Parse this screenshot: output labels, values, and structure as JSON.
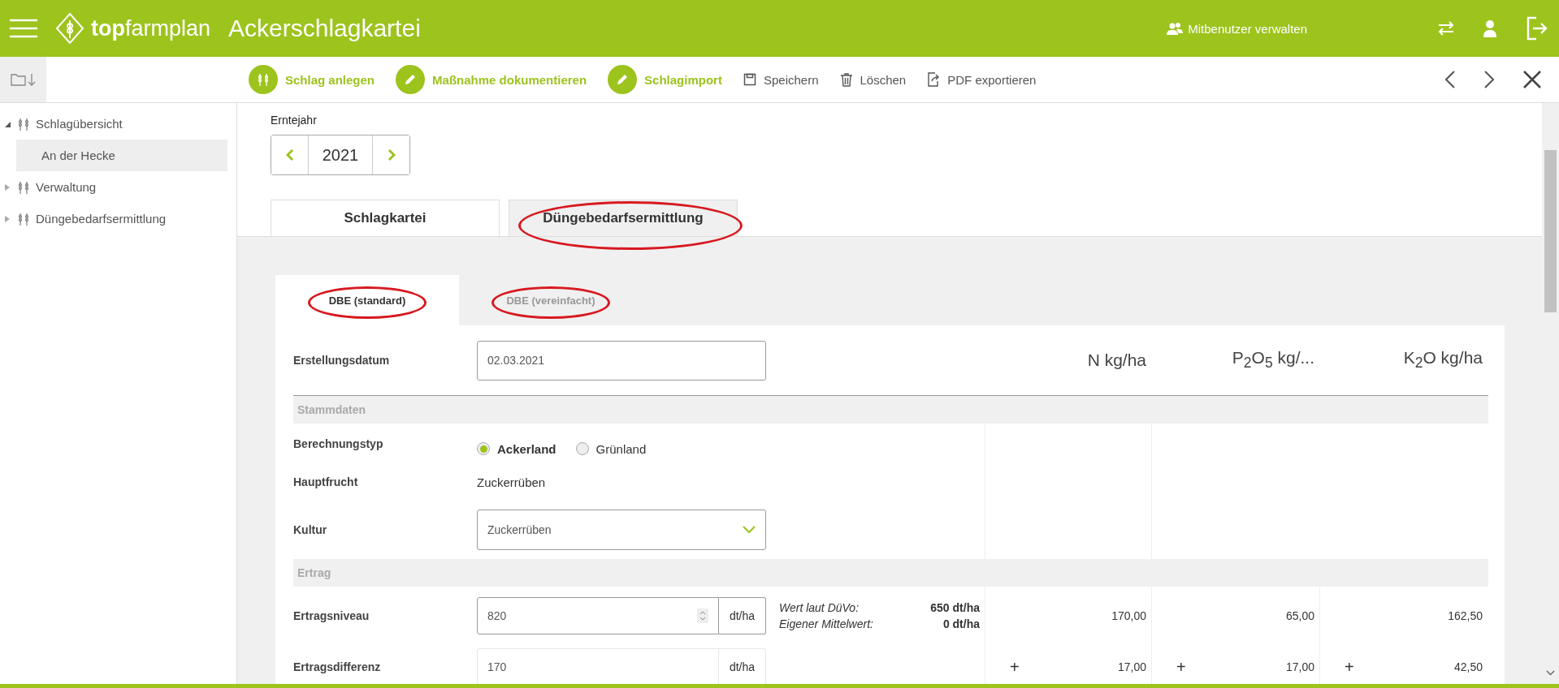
{
  "header": {
    "logo": "**top**farmplan",
    "title": "Ackerschlagkartei",
    "user_link": "Mitbenutzer verwalten"
  },
  "toolbar": {
    "actions": [
      {
        "label": "Schlag anlegen",
        "kind": "primary"
      },
      {
        "label": "Maßnahme dokumentieren",
        "kind": "primary"
      },
      {
        "label": "Schlagimport",
        "kind": "primary"
      },
      {
        "label": "Speichern",
        "kind": "plain"
      },
      {
        "label": "Löschen",
        "kind": "plain"
      },
      {
        "label": "PDF exportieren",
        "kind": "plain"
      }
    ]
  },
  "sidebar": {
    "items": [
      {
        "label": "Schlagübersicht",
        "expanded": true,
        "selected": false,
        "children": [
          {
            "label": "An der Hecke",
            "selected": true
          }
        ]
      },
      {
        "label": "Verwaltung",
        "expanded": false,
        "selected": false
      },
      {
        "label": "Düngebedarfsermittlung",
        "expanded": false,
        "selected": false
      }
    ]
  },
  "year": {
    "label": "Erntejahr",
    "value": "2021"
  },
  "tabs": [
    {
      "label": "Schlagkartei",
      "selected": false,
      "circled": false
    },
    {
      "label": "Düngebedarfsermittlung",
      "selected": true,
      "circled": true
    }
  ],
  "subtabs": [
    {
      "label": "DBE (standard)",
      "selected": true,
      "circled": true
    },
    {
      "label": "DBE (vereinfacht)",
      "selected": false,
      "circled": true
    }
  ],
  "form": {
    "date_label": "Erstellungsdatum",
    "date_value": "02.03.2021",
    "columns": [
      "N kg/ha",
      "P$_{2}$O$_{5}$ kg/...",
      "K$_{2}$O kg/ha"
    ],
    "sections": [
      {
        "title": "Stammdaten",
        "rows": [
          {
            "kind": "radio",
            "label": "Berechnungstyp",
            "options": [
              {
                "label": "Ackerland",
                "selected": true
              },
              {
                "label": "Grünland",
                "selected": false
              }
            ]
          },
          {
            "kind": "text",
            "label": "Hauptfrucht",
            "value": "Zuckerrüben"
          },
          {
            "kind": "select",
            "label": "Kultur",
            "value": "Zuckerrüben"
          }
        ]
      },
      {
        "title": "Ertrag",
        "rows": [
          {
            "kind": "number",
            "label": "Ertragsniveau",
            "value": "820",
            "unit": "dt/ha",
            "info": [
              {
                "label": "Wert laut DüVo:",
                "value": "650 dt/ha"
              },
              {
                "label": "Eigener Mittelwert:",
                "value": "0 dt/ha"
              }
            ],
            "values": [
              {
                "value": "170,00"
              },
              {
                "value": "65,00"
              },
              {
                "value": "162,50"
              }
            ]
          },
          {
            "kind": "readonly",
            "label": "Ertragsdifferenz",
            "value": "170",
            "unit": "dt/ha",
            "values": [
              {
                "sign": "+",
                "value": "17,00"
              },
              {
                "sign": "+",
                "value": "17,00"
              },
              {
                "sign": "+",
                "value": "42,50"
              }
            ]
          }
        ]
      }
    ]
  }
}
